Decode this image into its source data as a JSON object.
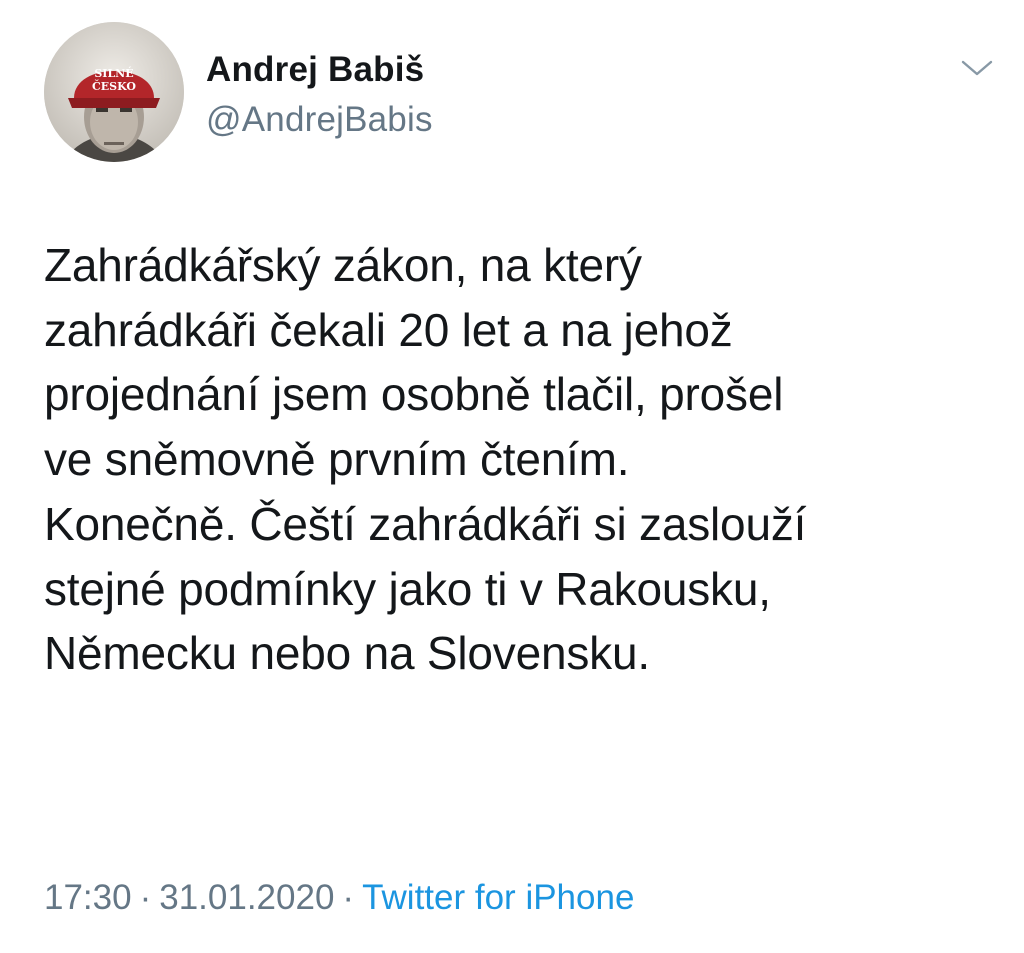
{
  "tweet": {
    "author": {
      "display_name": "Andrej Babiš",
      "handle": "@AndrejBabis",
      "avatar_cap_text_line1": "SILNÉ",
      "avatar_cap_text_line2": "ČESKO"
    },
    "text": "Zahrádkářský zákon, na který\nzahrádkáři čekali 20 let a na jehož\nprojednání jsem osobně tlačil, prošel\nve sněmovně prvním čtením.\nKonečně. Čeští zahrádkáři si zaslouží\nstejné podmínky jako ti v Rakousku,\nNěmecku nebo na Slovensku.",
    "time": "17:30",
    "separator": "·",
    "date": "31.01.2020",
    "source": "Twitter for iPhone",
    "menu_icon": "chevron-down-icon",
    "colors": {
      "text": "#14171a",
      "secondary": "#657786",
      "link": "#1b95e0"
    }
  }
}
